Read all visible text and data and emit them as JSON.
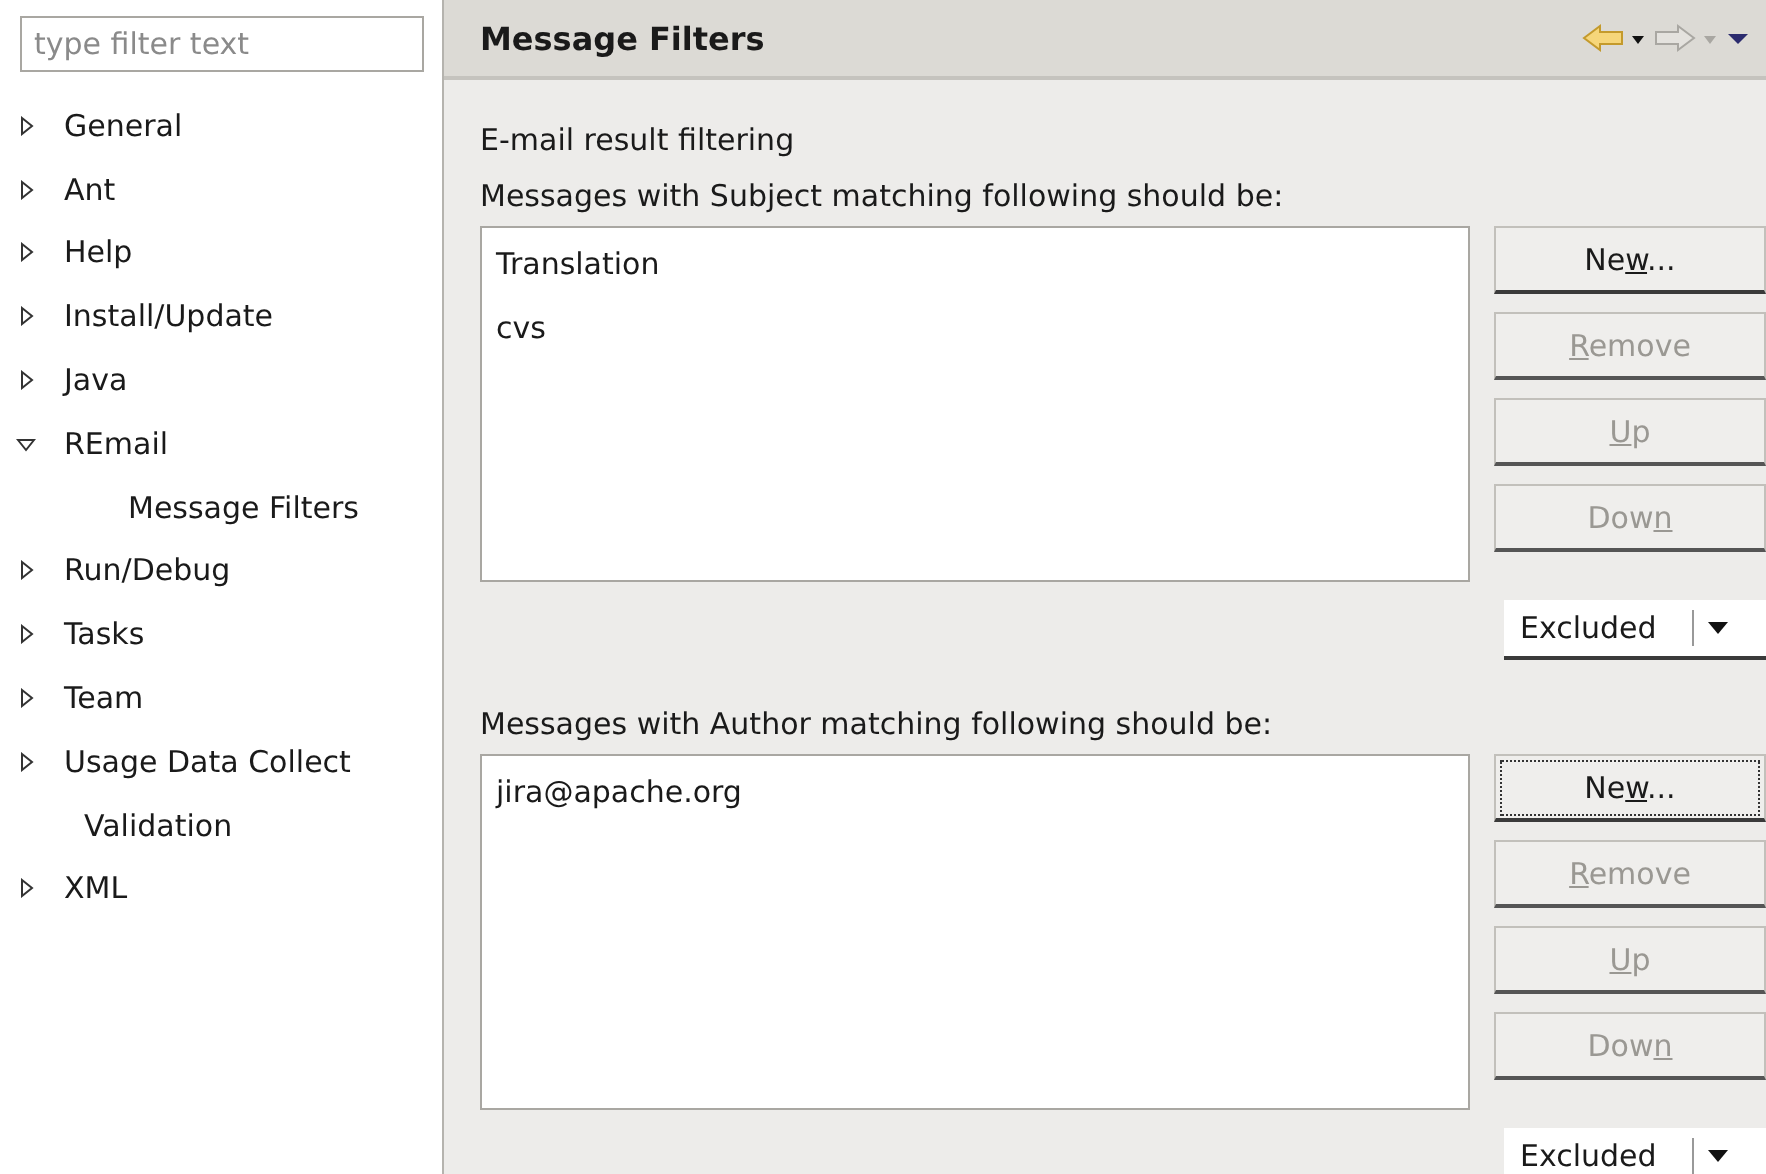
{
  "filter": {
    "placeholder": "type filter text"
  },
  "tree": [
    {
      "label": "General",
      "kind": "folder",
      "expanded": false
    },
    {
      "label": "Ant",
      "kind": "folder",
      "expanded": false
    },
    {
      "label": "Help",
      "kind": "folder",
      "expanded": false
    },
    {
      "label": "Install/Update",
      "kind": "folder",
      "expanded": false
    },
    {
      "label": "Java",
      "kind": "folder",
      "expanded": false
    },
    {
      "label": "REmail",
      "kind": "folder",
      "expanded": true,
      "children": [
        {
          "label": "Message Filters"
        }
      ]
    },
    {
      "label": "Run/Debug",
      "kind": "folder",
      "expanded": false
    },
    {
      "label": "Tasks",
      "kind": "folder",
      "expanded": false
    },
    {
      "label": "Team",
      "kind": "folder",
      "expanded": false
    },
    {
      "label": "Usage Data Collect",
      "kind": "folder",
      "expanded": false
    },
    {
      "label": "Validation",
      "kind": "leaf"
    },
    {
      "label": "XML",
      "kind": "folder",
      "expanded": false
    }
  ],
  "page": {
    "title": "Message Filters",
    "heading": "E-mail result filtering"
  },
  "sections": [
    {
      "label": "Messages with Subject matching following should be:",
      "items": [
        "Translation",
        "cvs"
      ],
      "buttons": [
        {
          "before": "Ne",
          "key": "w",
          "after": "...",
          "disabled": false,
          "focused": false
        },
        {
          "key": "R",
          "after": "emove",
          "disabled": true,
          "focused": false
        },
        {
          "key": "U",
          "after": "p",
          "disabled": true,
          "focused": false
        },
        {
          "before": "Dow",
          "key": "n",
          "disabled": true,
          "focused": false
        }
      ],
      "mode": "Excluded"
    },
    {
      "label": "Messages with Author matching following should be:",
      "items": [
        "jira@apache.org"
      ],
      "buttons": [
        {
          "before": "Ne",
          "key": "w",
          "after": "...",
          "disabled": false,
          "focused": true
        },
        {
          "key": "R",
          "after": "emove",
          "disabled": true,
          "focused": false
        },
        {
          "key": "U",
          "after": "p",
          "disabled": true,
          "focused": false
        },
        {
          "before": "Dow",
          "key": "n",
          "disabled": true,
          "focused": false
        }
      ],
      "mode": "Excluded"
    }
  ]
}
